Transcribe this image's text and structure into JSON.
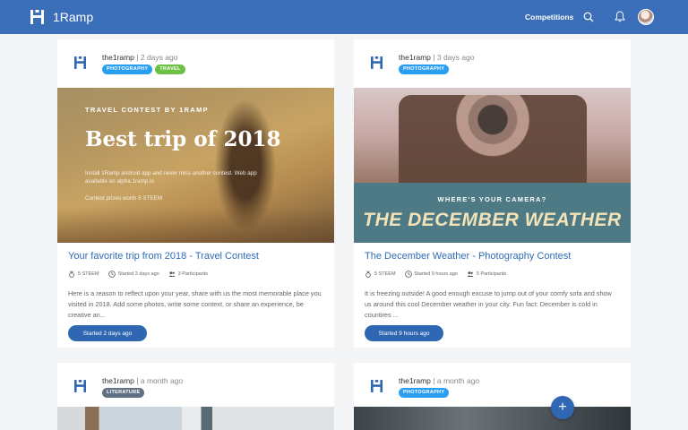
{
  "app": {
    "name": "1Ramp"
  },
  "nav": {
    "competitions_label": "Competitions"
  },
  "posts": [
    {
      "author": "the1ramp",
      "time": "| 2 days ago",
      "tags": [
        "PHOTOGRAPHY",
        "TRAVEL"
      ],
      "image": {
        "kicker": "TRAVEL CONTEST BY 1RAMP",
        "headline": "Best trip of 2018",
        "body": "Install 1Ramp android app and never miss another contest. Web app available on alpha.1ramp.io",
        "prize_note": "Contest prizes worth 5 STEEM"
      },
      "title": "Your favorite trip from 2018 - Travel Contest",
      "stats": {
        "prize": "5 STEEM",
        "started": "Started 2 days ago",
        "participants": "3 Participants"
      },
      "description": "Here is a reason to reflect upon your year, share with us the most memorable place you visited in 2018. Add some photos, write some context, or share an experience, be creative an...",
      "button": "Started 2 days ago"
    },
    {
      "author": "the1ramp",
      "time": "| 3 days ago",
      "tags": [
        "PHOTOGRAPHY"
      ],
      "image": {
        "kicker": "WHERE'S YOUR CAMERA?",
        "headline": "THE DECEMBER WEATHER"
      },
      "title": "The December Weather - Photography Contest",
      "stats": {
        "prize": "5 STEEM",
        "started": "Started 9 hours ago",
        "participants": "5 Participants"
      },
      "description": "It is freezing outside! A good enough excuse to jump out of your comfy sofa and show us around this cool December weather in your city. Fun fact: December is cold in countires ...",
      "button": "Started 9 hours ago"
    },
    {
      "author": "the1ramp",
      "time": "| a month ago",
      "tags": [
        "LITERATURE"
      ]
    },
    {
      "author": "the1ramp",
      "time": "| a month ago",
      "tags": [
        "PHOTOGRAPHY"
      ]
    }
  ],
  "fab": {
    "label": "+"
  },
  "colors": {
    "header": "#3a6eb8",
    "accent": "#2f67b3",
    "tag_blue": "#2a9ff2",
    "tag_green": "#6cc145",
    "tag_slate": "#5f7183"
  }
}
